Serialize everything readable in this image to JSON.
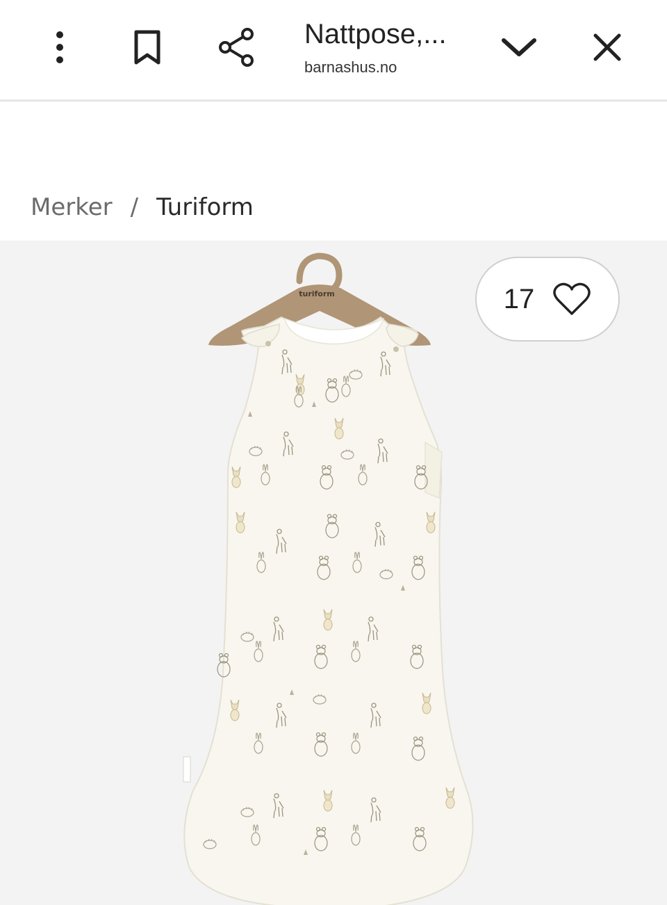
{
  "browser": {
    "tab_title": "Nattpose,...",
    "domain": "barnashus.no",
    "icons": {
      "menu": "more-vertical-icon",
      "bookmark": "bookmark-icon",
      "share": "share-icon",
      "collapse": "chevron-down-icon",
      "close": "close-icon"
    }
  },
  "breadcrumb": {
    "parent": "Merker",
    "separator": "/",
    "current": "Turiform"
  },
  "product": {
    "hanger_brand": "turiform",
    "favorite_count": "17",
    "favorite_icon": "heart-outline-icon"
  },
  "colors": {
    "hanger": "#b09576",
    "garment": "#f8f6ee",
    "image_background": "#f3f3f3"
  }
}
